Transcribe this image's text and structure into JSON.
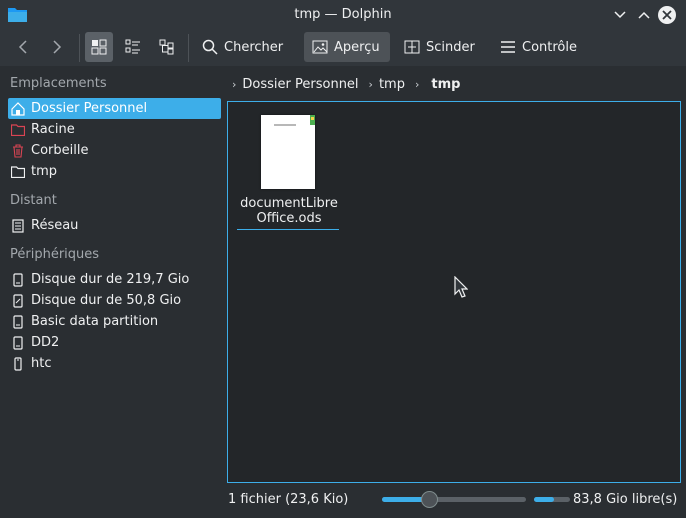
{
  "window": {
    "title": "tmp — Dolphin"
  },
  "toolbar": {
    "search_label": "Chercher",
    "preview_label": "Aperçu",
    "split_label": "Scinder",
    "control_label": "Contrôle"
  },
  "sidebar": {
    "places_title": "Emplacements",
    "places": [
      {
        "label": "Dossier Personnel",
        "icon": "home-icon"
      },
      {
        "label": "Racine",
        "icon": "root-folder-icon"
      },
      {
        "label": "Corbeille",
        "icon": "trash-icon"
      },
      {
        "label": "tmp",
        "icon": "folder-icon"
      }
    ],
    "remote_title": "Distant",
    "remote": [
      {
        "label": "Réseau",
        "icon": "network-icon"
      }
    ],
    "devices_title": "Périphériques",
    "devices": [
      {
        "label": "Disque dur de 219,7 Gio",
        "icon": "hard-drive-icon"
      },
      {
        "label": "Disque dur de 50,8 Gio",
        "icon": "hard-drive-icon"
      },
      {
        "label": "Basic data partition",
        "icon": "hard-drive-icon"
      },
      {
        "label": "DD2",
        "icon": "hard-drive-icon"
      },
      {
        "label": "htc",
        "icon": "phone-icon"
      }
    ]
  },
  "breadcrumb": [
    "Dossier Personnel",
    "tmp",
    "tmp"
  ],
  "files": [
    {
      "name": "documentLibreOffice.ods"
    }
  ],
  "status": {
    "summary": "1 fichier (23,6 Kio)",
    "zoom_fraction": 0.33,
    "free_space_label": "83,8 Gio libre(s)",
    "used_fraction": 0.55
  },
  "colors": {
    "accent": "#3daee9",
    "window_bg": "#31363b",
    "view_bg": "#232629"
  }
}
